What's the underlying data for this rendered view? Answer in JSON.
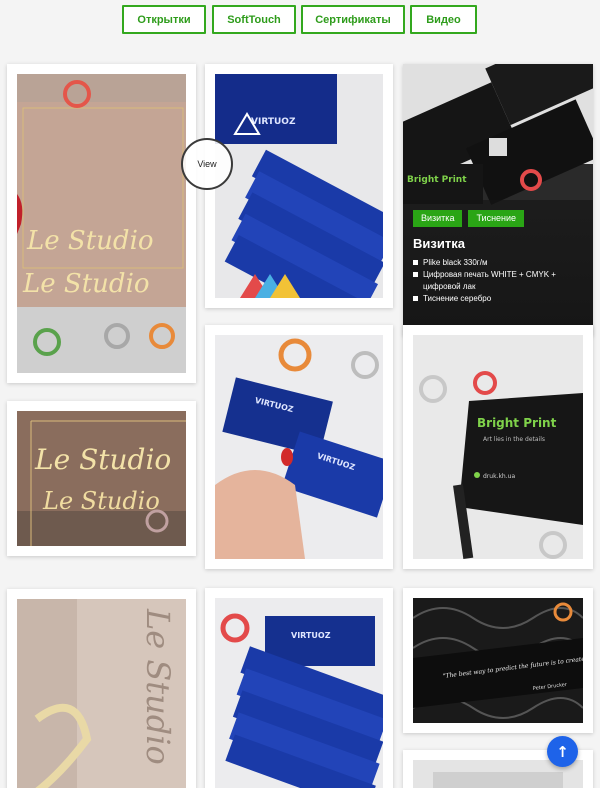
{
  "filters": [
    {
      "label": "Открытки"
    },
    {
      "label": "SoftTouch"
    },
    {
      "label": "Сертификаты"
    },
    {
      "label": "Видео"
    }
  ],
  "hover_view_label": "View",
  "featured": {
    "tags": [
      "Визитка",
      "Тиснение"
    ],
    "title": "Визитка",
    "features": [
      "Plike black 330г/м",
      "Цифровая печать WHITE + CMYK + цифровой лак",
      "Тиснение серебро"
    ]
  },
  "photo_texts": {
    "le_studio": "Le Studio",
    "virtuoz": "VIRTUOZ",
    "bright_print": "Bright Print",
    "bright_tagline": "Art lies in the details",
    "bright_contact": "druk.kh.ua",
    "quote": "\"The best way to predict the future is to create it.\"",
    "quote_author": "Peter Drucker"
  },
  "scroll_top_icon": "arrow-up-icon",
  "colors": {
    "accent_green": "#33a81e",
    "scroll_blue": "#1e63e9"
  }
}
